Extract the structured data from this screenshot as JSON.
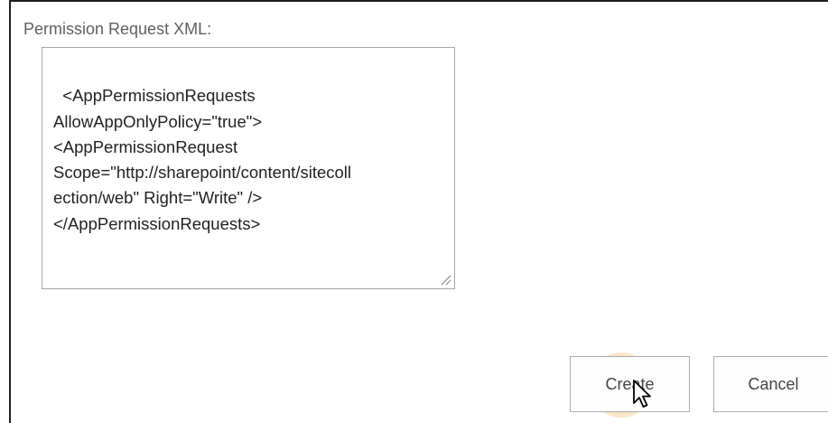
{
  "form": {
    "permission_label": "Permission Request XML:",
    "permission_xml": "<AppPermissionRequests\nAllowAppOnlyPolicy=\"true\">\n<AppPermissionRequest\nScope=\"http://sharepoint/content/sitecoll\nection/web\" Right=\"Write\" />\n</AppPermissionRequests>",
    "create_label": "Create",
    "cancel_label": "Cancel"
  },
  "icons": {
    "resize": "resize-grip-icon",
    "cursor": "mouse-pointer-icon"
  },
  "colors": {
    "click_highlight": "#f4c882",
    "frame_border": "#1f1f1f",
    "button_border": "#ababab"
  }
}
